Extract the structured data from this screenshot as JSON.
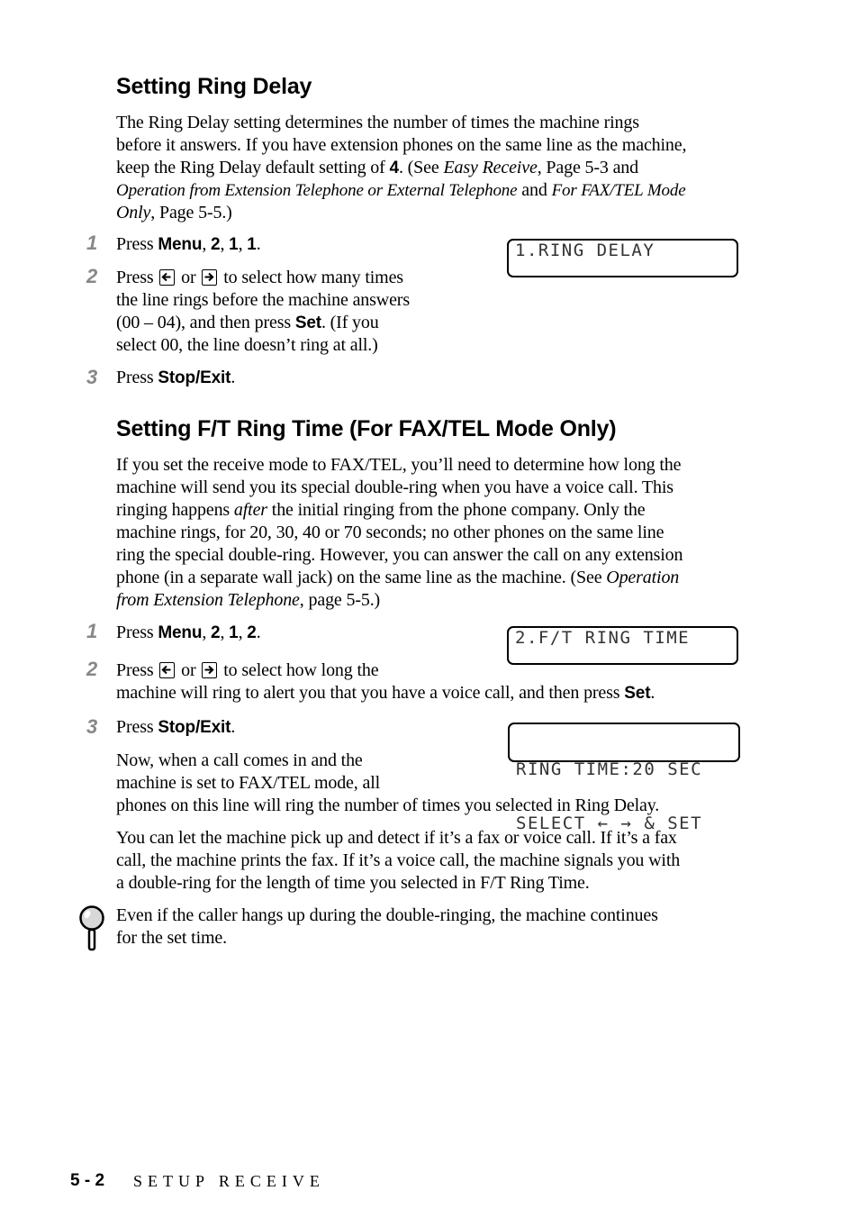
{
  "section1": {
    "heading": "Setting Ring Delay",
    "intro": {
      "l1": "The Ring Delay setting determines the number of times the machine rings",
      "l2": "before it answers.  If you have extension phones on the same line as the machine,",
      "l3a": "keep the Ring Delay default setting of ",
      "l3b": "4",
      "l3c": ". (See ",
      "l3d": "Easy Receive",
      "l3e": ", Page 5-3 and",
      "l4a": "Operation from Extension Telephone or External Telephone",
      "l4b": " and ",
      "l4c": "For FAX/TEL Mode",
      "l5a": "Only",
      "l5b": ", Page 5-5.)"
    },
    "steps": [
      {
        "num": "1",
        "press": "Press ",
        "keys": "Menu",
        "rest": ", ",
        "k2": "2",
        "s2": ", ",
        "k3": "1",
        "s3": ", ",
        "k4": "1",
        "end": "."
      },
      {
        "num": "2",
        "a": "Press ",
        "or": " or ",
        "b": " to select how many times",
        "l2": "the line rings before the machine answers",
        "l3a": "(00 – 04), and then press ",
        "l3b": "Set",
        "l3c": ". (If you",
        "l4": "select 00, the line doesn’t ring at all.)"
      },
      {
        "num": "3",
        "press": "Press ",
        "key": "Stop/Exit",
        "end": "."
      }
    ],
    "lcd": "1.RING DELAY"
  },
  "section2": {
    "heading": "Setting F/T Ring Time (For FAX/TEL Mode Only)",
    "intro": {
      "l1": "If you set the receive mode to FAX/TEL, you’ll need to determine how long the",
      "l2": "machine will send you its special double-ring when you have a voice call.  This",
      "l3a": "ringing happens ",
      "l3b": "after",
      "l3c": " the initial ringing from the phone company.  Only the",
      "l4": "machine rings, for 20, 30, 40 or 70 seconds; no other phones on the same line",
      "l5": "ring the special double-ring. However, you can answer the call on any extension",
      "l6a": "phone (in a separate wall jack) on the same line as the machine. (See ",
      "l6b": "Operation",
      "l7a": "from Extension Telephone",
      "l7b": ", page 5-5.)"
    },
    "steps": [
      {
        "num": "1",
        "press": "Press ",
        "keys": "Menu",
        "rest": ", ",
        "k2": "2",
        "s2": ", ",
        "k3": "1",
        "s3": ", ",
        "k4": "2",
        "end": "."
      },
      {
        "num": "2",
        "a": "Press ",
        "or": " or ",
        "b": " to select how long the",
        "l2a": "machine will ring to alert you that you have a voice call, and then press ",
        "l2b": "Set",
        "l2c": "."
      },
      {
        "num": "3",
        "press": "Press ",
        "key": "Stop/Exit",
        "end": "."
      }
    ],
    "lcd1": "2.F/T RING TIME",
    "lcd2_line1": "RING TIME:20 SEC",
    "lcd2_line2": "SELECT ← → & SET",
    "after": {
      "l1": "Now, when a call comes in and the",
      "l2": "machine is set to FAX/TEL mode, all",
      "l3": "phones on this line will ring the number of times you selected in Ring Delay."
    },
    "para2": {
      "l1": "You can let the machine pick up and detect if it’s a fax or voice call. If it’s a fax",
      "l2": "call, the machine prints the fax. If it’s a voice call, the machine signals you with",
      "l3": "a double-ring for the length of time you selected in F/T Ring Time."
    },
    "note": {
      "icon": "magnifier-note-icon",
      "l1": "Even if the caller hangs up during the double-ringing, the machine continues",
      "l2": "for the set time."
    }
  },
  "footer": {
    "page": "5 - 2",
    "chapter": "SETUP RECEIVE"
  }
}
